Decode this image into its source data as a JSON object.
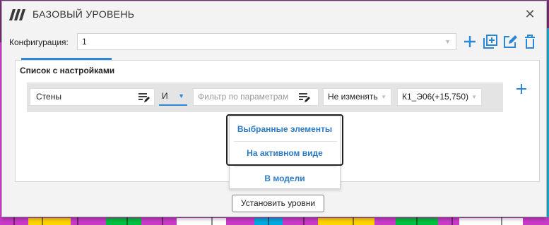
{
  "window": {
    "title": "БАЗОВЫЙ УРОВЕНЬ"
  },
  "config": {
    "label": "Конфигурация:",
    "value": "1"
  },
  "toolbar": {
    "icons": [
      "plus-icon",
      "duplicate-icon",
      "edit-icon",
      "trash-icon"
    ]
  },
  "panel": {
    "title": "Список с настройками",
    "rule": {
      "category": "Стены",
      "logic": "И",
      "filter_placeholder": "Фильтр по параметрам",
      "action": "Не изменять",
      "level": "К1_Э06(+15,750)"
    }
  },
  "dropdown": {
    "items": [
      "Выбранные элементы",
      "На активном виде",
      "В модели"
    ]
  },
  "footer": {
    "set_levels": "Установить уровни"
  },
  "colors": {
    "accent": "#2b88d8",
    "link": "#2b7bc7",
    "background": "#f3f3f3"
  }
}
